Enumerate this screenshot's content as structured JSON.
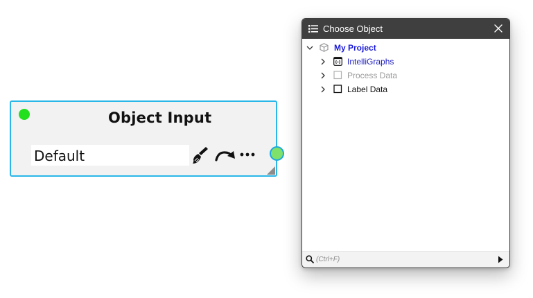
{
  "node": {
    "title": "Object Input",
    "value": "Default",
    "status_color": "#22e01e",
    "border_color": "#29b6e8",
    "icons": [
      "brush-icon",
      "redo-arrow-icon",
      "more-icon"
    ]
  },
  "chooser": {
    "title": "Choose Object",
    "icons": [
      "list-icon",
      "close-icon"
    ],
    "tree": {
      "root": {
        "label": "My Project",
        "icon": "cube-icon",
        "expanded": true
      },
      "items": [
        {
          "label": "IntelliGraphs",
          "icon": "graph-box-icon",
          "style": "link"
        },
        {
          "label": "Process Data",
          "icon": "checkbox-icon",
          "style": "disabled"
        },
        {
          "label": "Label Data",
          "icon": "checkbox-icon",
          "style": "normal"
        }
      ]
    },
    "search": {
      "placeholder": "(Ctrl+F)",
      "value": ""
    }
  }
}
